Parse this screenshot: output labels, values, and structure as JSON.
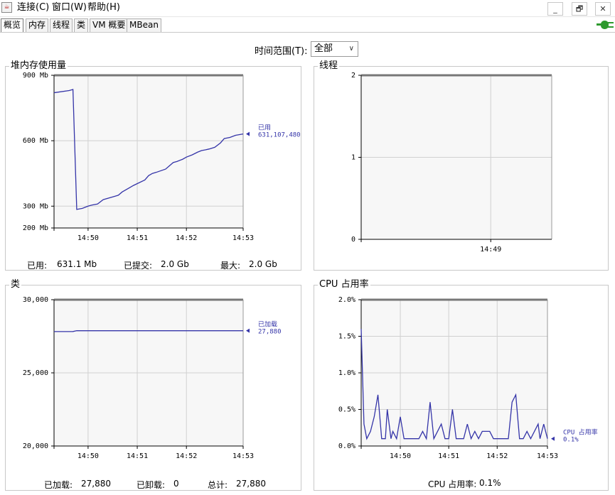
{
  "menu": {
    "connect": "连接(C)",
    "window": "窗口(W)",
    "help": "帮助(H)"
  },
  "window_buttons": {
    "minimize": "_",
    "restore": "🗗",
    "close": "✕"
  },
  "tabs": [
    "概览",
    "内存",
    "线程",
    "类",
    "VM 概要",
    "MBean"
  ],
  "time_range": {
    "label": "时间范围(T):",
    "value": "全部"
  },
  "colors": {
    "line": "#3434a8",
    "grid": "#d0d0d0",
    "plot_bg": "#f7f7f7",
    "plug": "#2e9a2e"
  },
  "panels": {
    "heap": {
      "title": "堆内存使用量",
      "stats": [
        {
          "label": "已用:",
          "value": "631.1 Mb"
        },
        {
          "label": "已提交:",
          "value": "2.0 Gb"
        },
        {
          "label": "最大:",
          "value": "2.0 Gb"
        }
      ]
    },
    "threads": {
      "title": "线程",
      "stats": []
    },
    "classes": {
      "title": "类",
      "stats": [
        {
          "label": "已加载:",
          "value": "27,880"
        },
        {
          "label": "已卸载:",
          "value": "0"
        },
        {
          "label": "总计:",
          "value": "27,880"
        }
      ]
    },
    "cpu": {
      "title": "CPU 占用率",
      "stats": [
        {
          "label": "CPU 占用率:",
          "value": "0.1%"
        }
      ]
    }
  },
  "chart_data": [
    {
      "type": "line",
      "title": "堆内存使用量",
      "ylim": [
        200,
        900
      ],
      "yticks": [
        "900 Mb",
        "600 Mb",
        "300 Mb",
        "200 Mb"
      ],
      "ytick_values": [
        900,
        600,
        300,
        200
      ],
      "xlim": [
        0,
        100
      ],
      "xticks": [
        "14:50",
        "14:51",
        "14:52",
        "14:53"
      ],
      "xtick_values": [
        18,
        44,
        70,
        100
      ],
      "series": [
        {
          "name": "已用",
          "value_label": "631,107,480",
          "x": [
            0,
            8,
            10,
            12,
            15,
            18,
            20,
            23,
            26,
            32,
            34,
            36,
            40,
            42,
            48,
            50,
            52,
            54,
            59,
            61,
            63,
            65,
            68,
            70,
            73,
            76,
            78,
            80,
            82,
            85,
            88,
            90,
            93,
            96,
            100
          ],
          "y": [
            820,
            830,
            835,
            285,
            290,
            300,
            305,
            310,
            330,
            345,
            350,
            365,
            385,
            395,
            420,
            440,
            450,
            455,
            470,
            485,
            500,
            505,
            515,
            525,
            535,
            548,
            555,
            558,
            562,
            570,
            590,
            610,
            615,
            625,
            631
          ]
        }
      ]
    },
    {
      "type": "line",
      "title": "线程",
      "ylim": [
        0,
        2
      ],
      "yticks": [
        "2",
        "1",
        "0"
      ],
      "ytick_values": [
        2,
        1,
        0
      ],
      "xlim": [
        0,
        100
      ],
      "xticks": [
        "14:49"
      ],
      "xtick_values": [
        68
      ],
      "series": []
    },
    {
      "type": "line",
      "title": "类",
      "ylim": [
        20000,
        30000
      ],
      "yticks": [
        "30,000",
        "25,000",
        "20,000"
      ],
      "ytick_values": [
        30000,
        25000,
        20000
      ],
      "xlim": [
        0,
        100
      ],
      "xticks": [
        "14:50",
        "14:51",
        "14:52",
        "14:53"
      ],
      "xtick_values": [
        18,
        44,
        70,
        100
      ],
      "series": [
        {
          "name": "已加载",
          "value_label": "27,880",
          "x": [
            0,
            10,
            12,
            100
          ],
          "y": [
            27820,
            27825,
            27880,
            27880
          ]
        }
      ]
    },
    {
      "type": "line",
      "title": "CPU 占用率",
      "ylim": [
        0,
        2
      ],
      "yticks": [
        "2.0%",
        "1.5%",
        "1.0%",
        "0.5%",
        "0.0%"
      ],
      "ytick_values": [
        2.0,
        1.5,
        1.0,
        0.5,
        0.0
      ],
      "xlim": [
        0,
        100
      ],
      "xticks": [
        "14:50",
        "14:51",
        "14:52",
        "14:53"
      ],
      "xtick_values": [
        21,
        47,
        73,
        100
      ],
      "series": [
        {
          "name": "CPU 占用率",
          "value_label": "0.1%",
          "x": [
            0,
            1.5,
            3,
            5,
            7,
            9,
            11,
            13,
            14,
            16,
            17,
            19,
            21,
            23,
            25,
            27,
            31,
            33,
            35,
            37,
            39,
            41,
            43,
            45,
            47,
            49,
            51,
            53,
            55,
            57,
            59,
            61,
            63,
            65,
            67,
            69,
            71,
            73,
            74,
            75,
            77,
            79,
            81,
            83,
            85,
            87,
            89,
            91,
            93,
            95,
            96,
            98,
            100
          ],
          "y": [
            1.6,
            0.3,
            0.1,
            0.2,
            0.4,
            0.7,
            0.1,
            0.1,
            0.5,
            0.1,
            0.2,
            0.1,
            0.4,
            0.1,
            0.1,
            0.1,
            0.1,
            0.2,
            0.1,
            0.6,
            0.1,
            0.2,
            0.3,
            0.1,
            0.1,
            0.5,
            0.1,
            0.1,
            0.1,
            0.3,
            0.1,
            0.2,
            0.1,
            0.2,
            0.2,
            0.2,
            0.1,
            0.1,
            0.1,
            0.1,
            0.1,
            0.1,
            0.6,
            0.7,
            0.1,
            0.1,
            0.2,
            0.1,
            0.2,
            0.3,
            0.1,
            0.3,
            0.1
          ]
        }
      ]
    }
  ]
}
